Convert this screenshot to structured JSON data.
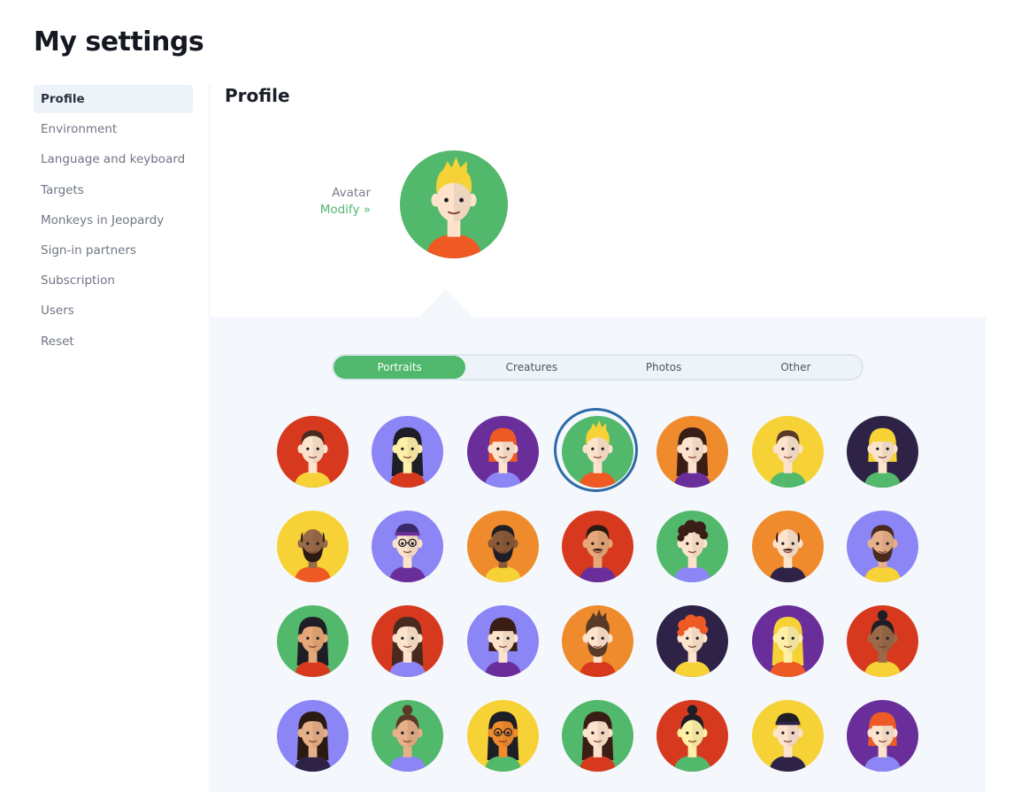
{
  "page": {
    "title": "My settings"
  },
  "sidebar": {
    "items": [
      {
        "label": "Profile",
        "active": true
      },
      {
        "label": "Environment"
      },
      {
        "label": "Language and keyboard"
      },
      {
        "label": "Targets"
      },
      {
        "label": "Monkeys in Jeopardy"
      },
      {
        "label": "Sign-in partners"
      },
      {
        "label": "Subscription"
      },
      {
        "label": "Users"
      },
      {
        "label": "Reset"
      }
    ]
  },
  "profile": {
    "section_title": "Profile",
    "avatar_label": "Avatar",
    "modify_label": "Modify »",
    "current_avatar": {
      "bg": "#52b86b",
      "skin": "#fde3cc",
      "hair": "#f6d237",
      "shirt": "#ef5a24",
      "style": "spiky"
    }
  },
  "picker": {
    "tabs": [
      {
        "label": "Portraits",
        "active": true
      },
      {
        "label": "Creatures"
      },
      {
        "label": "Photos"
      },
      {
        "label": "Other"
      }
    ],
    "selected_index": 3,
    "avatars": [
      {
        "bg": "#d7391f",
        "skin": "#fde3cc",
        "hair": "#4a2a1e",
        "shirt": "#f6d237",
        "style": "short"
      },
      {
        "bg": "#8b85f5",
        "skin": "#fff0a8",
        "hair": "#1e1e26",
        "shirt": "#d7391f",
        "style": "long"
      },
      {
        "bg": "#6a2e9b",
        "skin": "#fde3cc",
        "hair": "#ef5a24",
        "shirt": "#8b85f5",
        "style": "bob"
      },
      {
        "bg": "#52b86b",
        "skin": "#fde3cc",
        "hair": "#f6d237",
        "shirt": "#ef5a24",
        "style": "spiky"
      },
      {
        "bg": "#ef8b2c",
        "skin": "#fde3cc",
        "hair": "#3a1e16",
        "shirt": "#6a2e9b",
        "style": "long"
      },
      {
        "bg": "#f6d237",
        "skin": "#fde3cc",
        "hair": "#5a3a26",
        "shirt": "#52b86b",
        "style": "short"
      },
      {
        "bg": "#2e2346",
        "skin": "#fde3cc",
        "hair": "#f6d237",
        "shirt": "#52b86b",
        "style": "bob"
      },
      {
        "bg": "#f6d237",
        "skin": "#9a6a48",
        "hair": "#2a1a12",
        "shirt": "#ef5a24",
        "style": "bald",
        "beard": true
      },
      {
        "bg": "#8b85f5",
        "skin": "#fde3cc",
        "hair": "#3a2a6a",
        "shirt": "#6a2e9b",
        "style": "cap",
        "glasses": true
      },
      {
        "bg": "#ef8b2c",
        "skin": "#8a5a38",
        "hair": "#1e1e26",
        "shirt": "#f6d237",
        "style": "short",
        "beard": true
      },
      {
        "bg": "#d7391f",
        "skin": "#e6a878",
        "hair": "#2a1a12",
        "shirt": "#6a2e9b",
        "style": "short",
        "mustache": true
      },
      {
        "bg": "#52b86b",
        "skin": "#fde3cc",
        "hair": "#3a1e16",
        "shirt": "#8b85f5",
        "style": "curly"
      },
      {
        "bg": "#ef8b2c",
        "skin": "#fde3cc",
        "hair": "#3a1e16",
        "shirt": "#2e2346",
        "style": "bald",
        "mustache": true
      },
      {
        "bg": "#8b85f5",
        "skin": "#e6b088",
        "hair": "#4a2a1e",
        "shirt": "#f6d237",
        "style": "short",
        "beard": true
      },
      {
        "bg": "#52b86b",
        "skin": "#e6a878",
        "hair": "#1e1e26",
        "shirt": "#d7391f",
        "style": "long"
      },
      {
        "bg": "#d7391f",
        "skin": "#fde3cc",
        "hair": "#4a2a1e",
        "shirt": "#8b85f5",
        "style": "long"
      },
      {
        "bg": "#8b85f5",
        "skin": "#fde3cc",
        "hair": "#3a1e16",
        "shirt": "#6a2e9b",
        "style": "bob"
      },
      {
        "bg": "#ef8b2c",
        "skin": "#fde3cc",
        "hair": "#5a3a26",
        "shirt": "#d7391f",
        "style": "spiky",
        "beard": true
      },
      {
        "bg": "#2e2346",
        "skin": "#fde3cc",
        "hair": "#ef5a24",
        "shirt": "#f6d237",
        "style": "curly"
      },
      {
        "bg": "#6a2e9b",
        "skin": "#fff0a8",
        "hair": "#f6d237",
        "shirt": "#ef5a24",
        "style": "long"
      },
      {
        "bg": "#d7391f",
        "skin": "#9a6a48",
        "hair": "#1e1e26",
        "shirt": "#f6d237",
        "style": "bun"
      },
      {
        "bg": "#8b85f5",
        "skin": "#e6b088",
        "hair": "#2a1a12",
        "shirt": "#2e2346",
        "style": "long"
      },
      {
        "bg": "#52b86b",
        "skin": "#e6b088",
        "hair": "#5a3a26",
        "shirt": "#8b85f5",
        "style": "bun"
      },
      {
        "bg": "#f6d237",
        "skin": "#ef8b2c",
        "hair": "#1e1e26",
        "shirt": "#52b86b",
        "style": "long",
        "glasses": true
      },
      {
        "bg": "#52b86b",
        "skin": "#fde3cc",
        "hair": "#3a1e16",
        "shirt": "#d7391f",
        "style": "long"
      },
      {
        "bg": "#d7391f",
        "skin": "#fff0a8",
        "hair": "#1e1e26",
        "shirt": "#52b86b",
        "style": "bun"
      },
      {
        "bg": "#f6d237",
        "skin": "#fde3cc",
        "hair": "#1e1e26",
        "shirt": "#2e2346",
        "style": "cap"
      },
      {
        "bg": "#6a2e9b",
        "skin": "#fde3cc",
        "hair": "#ef5a24",
        "shirt": "#8b85f5",
        "style": "bob"
      }
    ]
  }
}
